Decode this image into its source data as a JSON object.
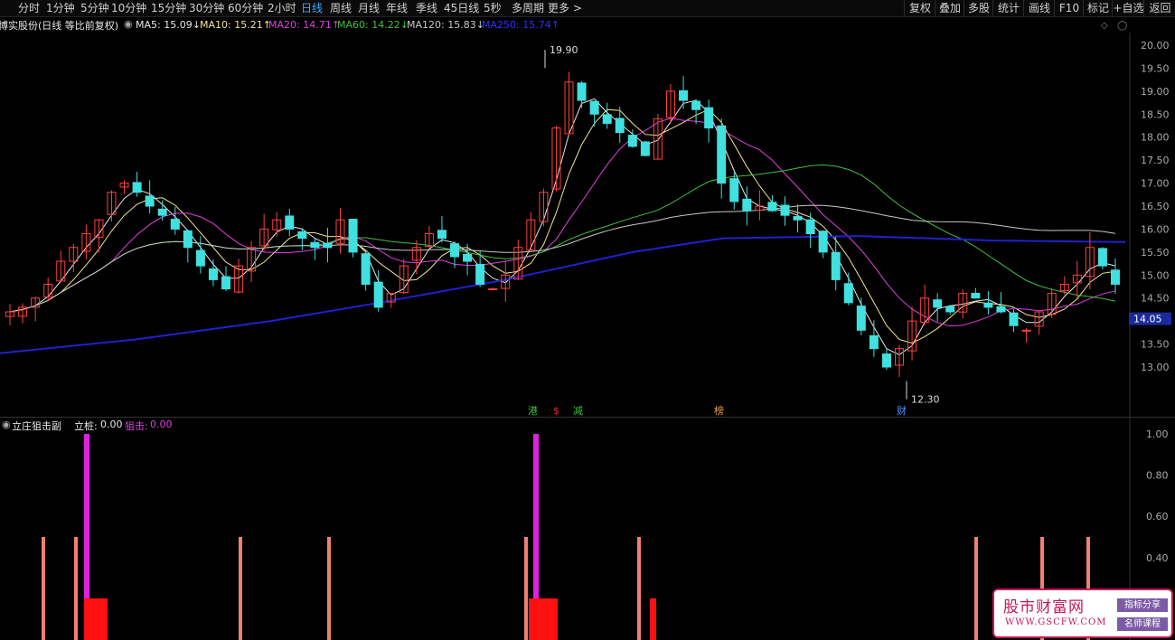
{
  "periods": [
    "分时",
    "1分钟",
    "5分钟",
    "10分钟",
    "15分钟",
    "30分钟",
    "60分钟",
    "2小时",
    "日线",
    "周线",
    "月线",
    "年线",
    "季线",
    "45日线",
    "5秒",
    "多周期",
    "更多"
  ],
  "active_period": "日线",
  "right_buttons": [
    "复权",
    "叠加",
    "多股",
    "统计",
    "画线",
    "F10",
    "标记",
    "+自选",
    "返回"
  ],
  "stock_title": "博实股份(日线 等比前复权)",
  "ma_labels": [
    {
      "text": "MA5: 15.09↓",
      "color": "#e8e8e8"
    },
    {
      "text": "MA10: 15.21↑",
      "color": "#f0e68c"
    },
    {
      "text": "MA20: 14.71↑",
      "color": "#e040e0"
    },
    {
      "text": "MA60: 14.22↓",
      "color": "#40c040"
    },
    {
      "text": "MA120: 15.83↓",
      "color": "#c8c8c8"
    },
    {
      "text": "MA250: 15.74↑",
      "color": "#3030ff"
    }
  ],
  "price_axis": [
    "20.00",
    "19.50",
    "19.00",
    "18.50",
    "18.00",
    "17.50",
    "17.00",
    "16.50",
    "16.00",
    "15.50",
    "15.00",
    "14.50",
    "14.00",
    "13.50",
    "13.00"
  ],
  "current_price": "14.05",
  "high_marker": "19.90",
  "low_marker": "12.30",
  "event_markers": [
    {
      "text": "港",
      "color": "#40c040"
    },
    {
      "text": "$",
      "color": "#e03030"
    },
    {
      "text": "减",
      "color": "#40c040"
    },
    {
      "text": "榜",
      "color": "#e8a050"
    },
    {
      "text": "财",
      "color": "#5090ff"
    }
  ],
  "indicator": {
    "name": "立庄狙击副",
    "li_zhuang_label": "立桩:",
    "li_zhuang_value": "0.00",
    "ju_ji_label": "狙击:",
    "ju_ji_value": "0.00",
    "axis": [
      "1.00",
      "0.80",
      "0.60",
      "0.40"
    ]
  },
  "watermark": {
    "title": "股市财富网",
    "url": "WWW.GSCFW.COM",
    "tag1": "指标分享",
    "tag2": "名师课程"
  },
  "colors": {
    "up": "#ff4040",
    "down": "#40e0e0",
    "ma250": "#2020d0",
    "background": "#000000"
  },
  "chart_data": {
    "type": "candlestick",
    "approx_close_series": [
      14.2,
      14.3,
      14.5,
      14.8,
      15.3,
      15.6,
      15.9,
      16.2,
      16.8,
      17.0,
      16.8,
      16.5,
      16.3,
      16.0,
      15.6,
      15.2,
      14.9,
      14.7,
      15.2,
      15.6,
      16.0,
      16.2,
      16.0,
      15.8,
      15.6,
      15.6,
      16.2,
      15.5,
      14.8,
      14.3,
      14.6,
      15.2,
      15.6,
      15.9,
      15.8,
      15.4,
      15.3,
      14.8,
      14.7,
      15.0,
      15.6,
      16.2,
      16.8,
      18.2,
      19.2,
      18.8,
      18.5,
      18.3,
      18.1,
      17.8,
      17.6,
      18.4,
      19.0,
      18.8,
      18.6,
      18.2,
      17.0,
      16.6,
      16.4,
      16.5,
      16.4,
      16.3,
      16.2,
      15.9,
      15.5,
      14.9,
      14.4,
      13.8,
      13.4,
      13.0,
      13.4,
      14.0,
      14.5,
      14.3,
      14.2,
      14.6,
      14.5,
      14.3,
      14.2,
      13.9,
      13.8,
      14.2,
      14.6,
      14.8,
      15.0,
      15.6,
      15.2,
      14.8
    ],
    "y_range": [
      12.5,
      20.3
    ],
    "high": 19.9,
    "low": 12.3
  }
}
